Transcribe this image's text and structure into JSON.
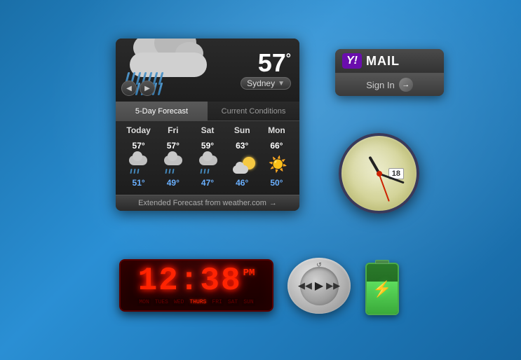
{
  "weather": {
    "temperature": "57",
    "unit": "°",
    "city": "Sydney",
    "tab_5day": "5-Day Forecast",
    "tab_current": "Current Conditions",
    "extended_link": "Extended Forecast from weather.com",
    "days": [
      "Today",
      "Fri",
      "Sat",
      "Sun",
      "Mon"
    ],
    "highs": [
      "57°",
      "57°",
      "59°",
      "63°",
      "66°"
    ],
    "lows": [
      "51°",
      "49°",
      "47°",
      "46°",
      "50°"
    ],
    "icon_types": [
      "rain",
      "rain",
      "rain",
      "partly",
      "sunny"
    ]
  },
  "yahoo_mail": {
    "logo_y": "Y!",
    "title": "MAIL",
    "signin_label": "Sign In"
  },
  "clock": {
    "date": "18",
    "hour_rotation": "-30",
    "minute_rotation": "110",
    "second_rotation": "160"
  },
  "digital_clock": {
    "time": "12:38",
    "ampm": "PM",
    "days": [
      "MON",
      "TUES",
      "WED",
      "THURS",
      "FRI",
      "SAT",
      "SUN"
    ],
    "active_day": "THURS"
  },
  "battery": {
    "plug_icon": "⚡"
  },
  "media_player": {
    "prev_icon": "◀◀",
    "play_icon": "▶",
    "next_icon": "▶▶",
    "top_icon": "↺"
  }
}
